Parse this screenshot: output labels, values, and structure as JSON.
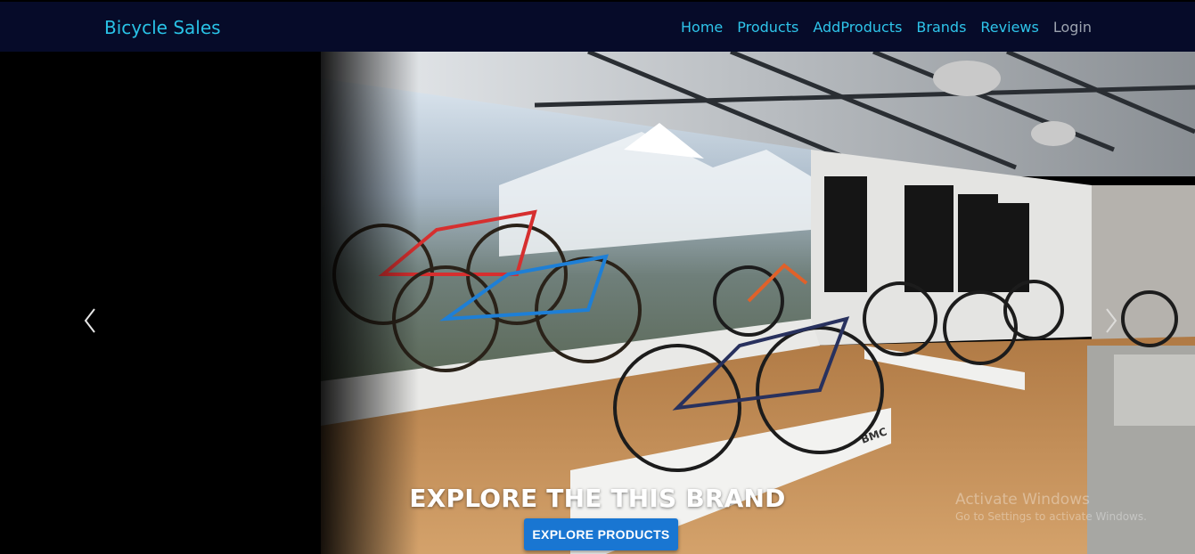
{
  "nav": {
    "brand": "Bicycle Sales",
    "links": [
      {
        "label": "Home"
      },
      {
        "label": "Products"
      },
      {
        "label": "AddProducts"
      },
      {
        "label": "Brands"
      },
      {
        "label": "Reviews"
      },
      {
        "label": "Login"
      }
    ]
  },
  "hero": {
    "caption": "EXPLORE THE THIS BRAND",
    "button_label": "EXPLORE PRODUCTS",
    "prev_icon": "chevron-left-icon",
    "next_icon": "chevron-right-icon",
    "photo_text": {
      "bmc_logo": "BMC"
    }
  },
  "watermark": {
    "title": "Activate Windows",
    "subtitle": "Go to Settings to activate Windows."
  },
  "colors": {
    "navbar_bg": "#060b29",
    "nav_link": "#2ec4ea",
    "nav_link_muted": "#9ca3af",
    "button_bg": "#1976d2"
  }
}
